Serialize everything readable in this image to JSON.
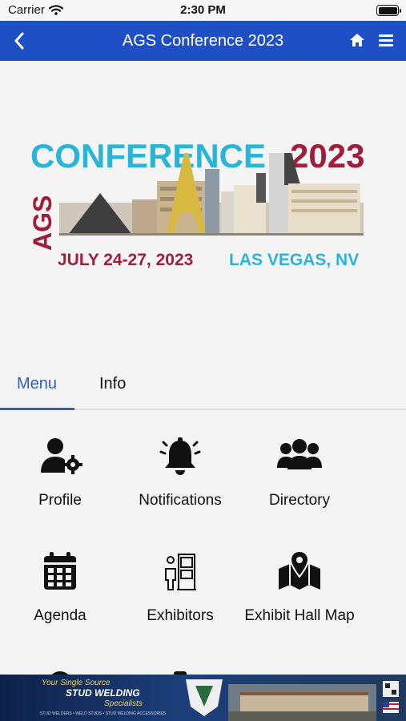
{
  "status_bar": {
    "carrier": "Carrier",
    "time": "2:30 PM",
    "wifi_icon": "wifi-icon",
    "battery_icon": "battery-icon",
    "battery_level": 1.0
  },
  "nav_bar": {
    "title": "AGS Conference 2023",
    "back_icon": "chevron-left-icon",
    "home_icon": "home-icon",
    "menu_icon": "hamburger-icon",
    "color": "#1f4fc4"
  },
  "banner": {
    "logo_letters": "AGS",
    "conference_word": "CONFERENCE",
    "year": "2023",
    "dates": "JULY 24-27, 2023",
    "location": "LAS VEGAS, NV",
    "colors": {
      "teal": "#2ab4d6",
      "maroon": "#9e1f3d"
    }
  },
  "tabs": [
    {
      "label": "Menu",
      "active": true
    },
    {
      "label": "Info",
      "active": false
    }
  ],
  "accent_color": "#2f5fc4",
  "menu_items": [
    {
      "label": "Profile",
      "icon": "user-gear-icon"
    },
    {
      "label": "Notifications",
      "icon": "bell-icon"
    },
    {
      "label": "Directory",
      "icon": "users-icon"
    },
    {
      "label": "Agenda",
      "icon": "calendar-icon"
    },
    {
      "label": "Exhibitors",
      "icon": "exhibitor-booth-icon"
    },
    {
      "label": "Exhibit Hall Map",
      "icon": "map-pin-icon"
    }
  ],
  "ad_banner": {
    "tagline": "Your Single Source",
    "headline": "STUD WELDING",
    "subline": "Specialists",
    "products": "STUD WELDERS • WELD STUDS • STUD WELDING ACCESSORIES"
  }
}
